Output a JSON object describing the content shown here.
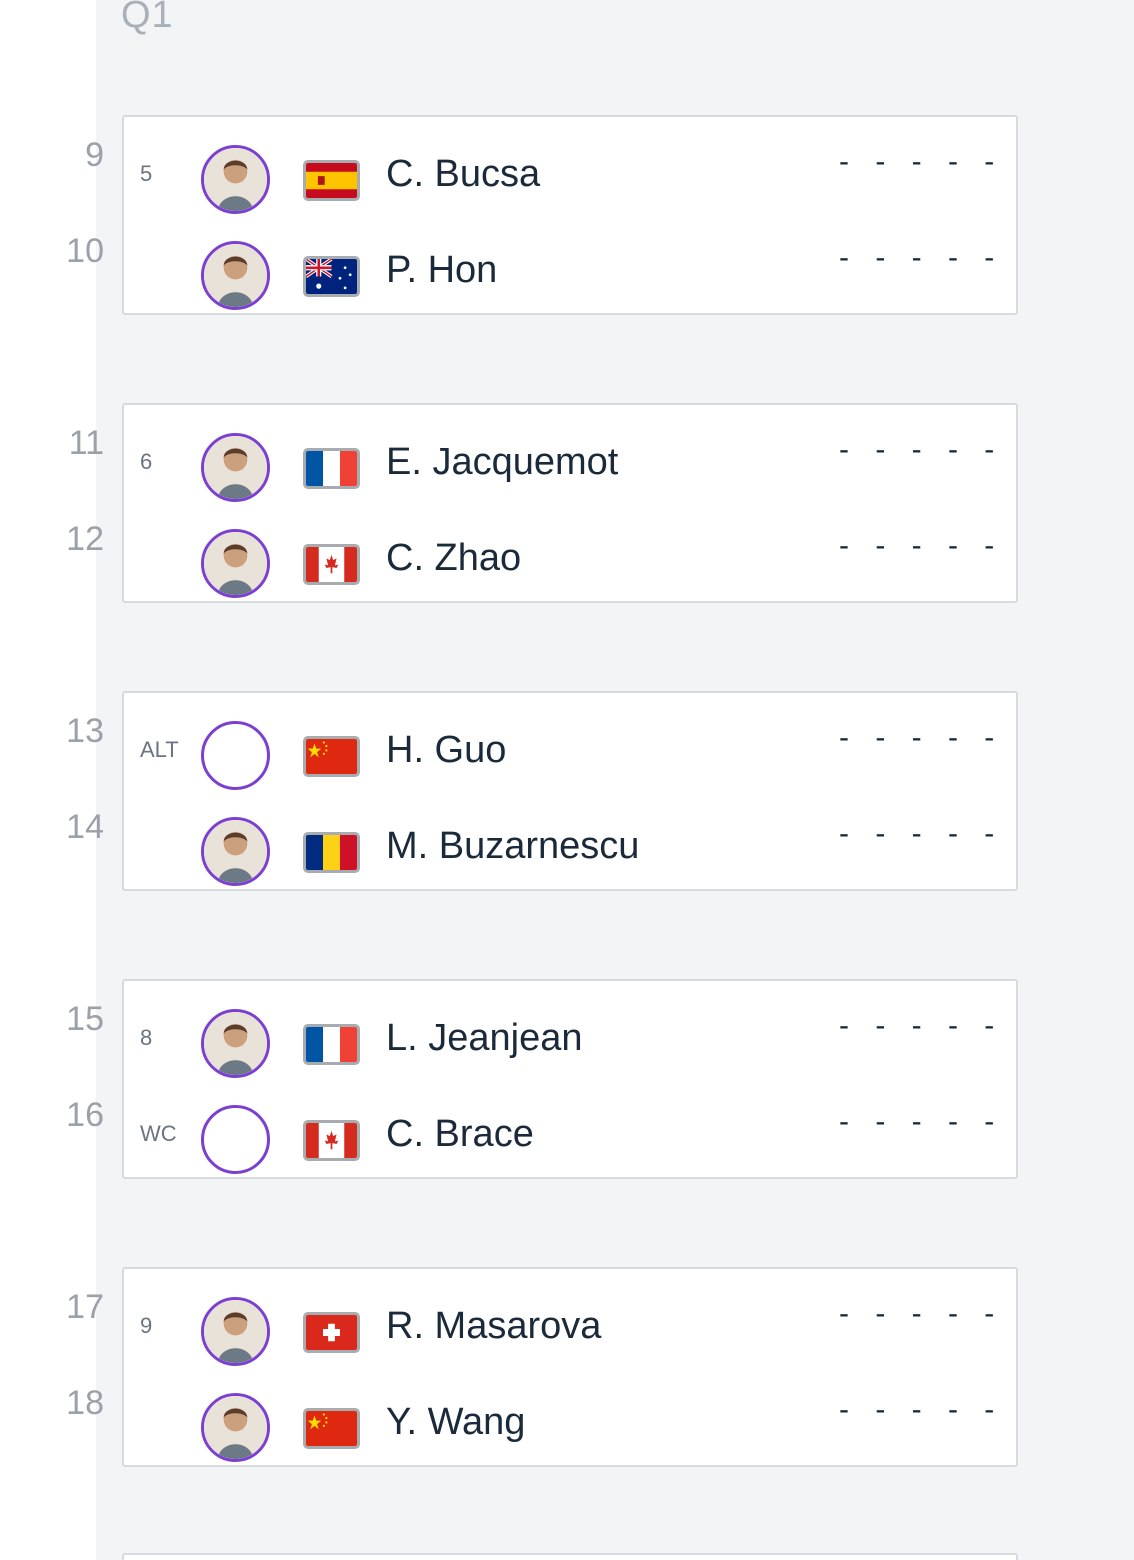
{
  "round_label": "Q1",
  "positions": [
    "9",
    "10",
    "11",
    "12",
    "13",
    "14",
    "15",
    "16",
    "17",
    "18"
  ],
  "matches": [
    {
      "players": [
        {
          "seed": "5",
          "name": "C. Bucsa",
          "country_flag": "spain-flag",
          "score": "- - - - -",
          "avatar": "player-photo"
        },
        {
          "seed": "",
          "name": "P. Hon",
          "country_flag": "australia-flag",
          "score": "- - - - -",
          "avatar": "player-photo"
        }
      ]
    },
    {
      "players": [
        {
          "seed": "6",
          "name": "E. Jacquemot",
          "country_flag": "france-flag",
          "score": "- - - - -",
          "avatar": "player-photo"
        },
        {
          "seed": "",
          "name": "C. Zhao",
          "country_flag": "canada-flag",
          "score": "- - - - -",
          "avatar": "player-photo"
        }
      ]
    },
    {
      "players": [
        {
          "seed": "ALT",
          "name": "H. Guo",
          "country_flag": "china-flag",
          "score": "- - - - -",
          "avatar": "empty"
        },
        {
          "seed": "",
          "name": "M. Buzarnescu",
          "country_flag": "romania-flag",
          "score": "- - - - -",
          "avatar": "player-photo"
        }
      ]
    },
    {
      "players": [
        {
          "seed": "8",
          "name": "L. Jeanjean",
          "country_flag": "france-flag",
          "score": "- - - - -",
          "avatar": "player-photo"
        },
        {
          "seed": "WC",
          "name": "C. Brace",
          "country_flag": "canada-flag",
          "score": "- - - - -",
          "avatar": "empty"
        }
      ]
    },
    {
      "players": [
        {
          "seed": "9",
          "name": "R. Masarova",
          "country_flag": "switzerland-flag",
          "score": "- - - - -",
          "avatar": "player-photo"
        },
        {
          "seed": "",
          "name": "Y. Wang",
          "country_flag": "china-flag",
          "score": "- - - - -",
          "avatar": "player-photo"
        }
      ]
    }
  ],
  "colors": {
    "avatar_ring": "#7b3fd1",
    "background": "#f3f4f6",
    "card_border": "#d7dade",
    "text": "#1b2a3a",
    "muted": "#9aa1a8"
  }
}
